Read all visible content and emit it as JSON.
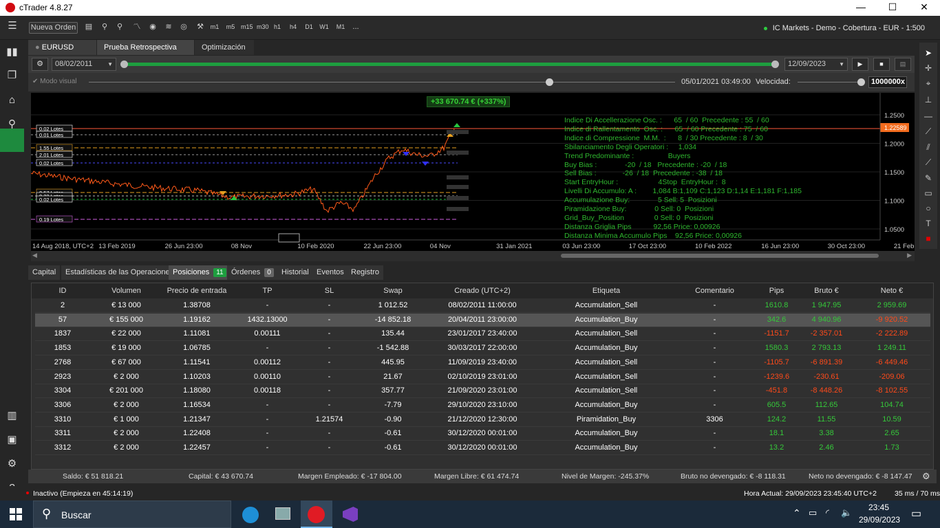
{
  "window": {
    "title": "cTrader 4.8.27"
  },
  "toolbar": {
    "new_order": "Nueva Orden",
    "timeframes": [
      "m1",
      "m5",
      "m15",
      "m30",
      "h1",
      "h4",
      "D1",
      "W1",
      "M1"
    ],
    "more": "...",
    "account": "IC Markets - Demo - Cobertura - EUR - 1:500"
  },
  "tabs": {
    "symbol": "EURUSD",
    "timeframe": "D1",
    "backtest": "Prueba Retrospectiva",
    "optimization": "Optimización"
  },
  "backtest": {
    "start_date": "08/02/2011",
    "end_date": "12/09/2023",
    "visual_mode": "Modo visual",
    "current_time": "05/01/2021 03:49:00",
    "speed_label": "Velocidad:",
    "speed_value": "1000000x"
  },
  "chart": {
    "profit_label": "+33 670.74 € (+337%)",
    "price_label": "1.22589",
    "y_ticks": [
      "1.2500",
      "1.2000",
      "1.1500",
      "1.1000",
      "1.0500"
    ],
    "y_tick_values": [
      1.25,
      1.2,
      1.15,
      1.1,
      1.05
    ],
    "x_ticks": [
      "14 Aug 2018, UTC+2",
      "13 Feb 2019",
      "26 Jun 23:00",
      "08 Nov",
      "10 Feb 2020",
      "22 Jun 23:00",
      "04 Nov",
      "31 Jan 2021",
      "03 Jun 23:00",
      "17 Oct 23:00",
      "10 Feb 2022",
      "16 Jun 23:00",
      "30 Oct 23:00",
      "21 Feb 2023"
    ],
    "lot_labels": [
      "0.02 Lotes",
      "0.01 Lotes",
      "1.55 Lotes",
      "2.01 Lotes",
      "0.02 Lotes",
      "0.57 Lotes",
      "0.22 Lotes",
      "0.02 Lotes",
      "0.19 Lotes"
    ],
    "info_lines": [
      "Indice Di Accellerazione Osc. :      65  / 60  Precedente : 55  / 60",
      "Indice di Rallentamento  Osc. :      65  / 60 Precedente : 75  / 60",
      "Indice di Compressione  M.M.  :      8  / 30 Precedente : 8  / 30",
      "Sbilanciamento Degli Operatori :     1,034",
      "Trend Predominante :                 Buyers",
      "Buy Bias :              -20  / 18   Precedente : -20  / 18",
      "Sell Bias :             -26  / 18  Precedente : -38  / 18",
      "Start EntryHour :                    4Stop  EntryHour :  8",
      "Livelli Di Accumulo: A :        1,084 B:1,109 C:1,123 D:1,14 E:1,181 F:1,185",
      "Accumulazione Buy:              5 Sell: 5  Posizioni",
      "Piramidazione Buy:              0 Sell: 0  Posizioni",
      "Grid_Buy_Position               0 Sell: 0  Posizioni",
      "Distanza Griglia Pips           92,56 Price: 0,00926",
      "Distanza Minima Accumulo Pips    92,56 Price: 0,00926"
    ]
  },
  "bottom_tabs": {
    "capital": "Capital",
    "stats": "Estadísticas de las Operaciones",
    "positions": "Posiciones",
    "positions_count": "11",
    "orders": "Órdenes",
    "orders_count": "0",
    "history": "Historial",
    "events": "Eventos",
    "log": "Registro"
  },
  "table": {
    "headers": [
      "ID",
      "Volumen",
      "Precio de entrada",
      "TP",
      "SL",
      "Swap",
      "Creado (UTC+2)",
      "Etiqueta",
      "Comentario",
      "Pips",
      "Bruto €",
      "Neto €"
    ],
    "rows": [
      [
        "2",
        "€ 13 000",
        "1.38708",
        "-",
        "-",
        "1 012.52",
        "08/02/2011 11:00:00",
        "Accumulation_Sell",
        "-",
        "1610.8",
        "1 947.95",
        "2 959.69"
      ],
      [
        "57",
        "€ 155 000",
        "1.19162",
        "1432.13000",
        "-",
        "-14 852.18",
        "20/04/2011 23:00:00",
        "Accumulation_Buy",
        "-",
        "342.6",
        "4 940.96",
        "-9 920.52"
      ],
      [
        "1837",
        "€ 22 000",
        "1.11081",
        "0.00111",
        "-",
        "135.44",
        "23/01/2017 23:40:00",
        "Accumulation_Sell",
        "-",
        "-1151.7",
        "-2 357.01",
        "-2 222.89"
      ],
      [
        "1853",
        "€ 19 000",
        "1.06785",
        "-",
        "-",
        "-1 542.88",
        "30/03/2017 22:00:00",
        "Accumulation_Buy",
        "-",
        "1580.3",
        "2 793.13",
        "1 249.11"
      ],
      [
        "2768",
        "€ 67 000",
        "1.11541",
        "0.00112",
        "-",
        "445.95",
        "11/09/2019 23:40:00",
        "Accumulation_Sell",
        "-",
        "-1105.7",
        "-6 891.39",
        "-6 449.46"
      ],
      [
        "2923",
        "€ 2 000",
        "1.10203",
        "0.00110",
        "-",
        "21.67",
        "02/10/2019 23:01:00",
        "Accumulation_Sell",
        "-",
        "-1239.6",
        "-230.61",
        "-209.06"
      ],
      [
        "3304",
        "€ 201 000",
        "1.18080",
        "0.00118",
        "-",
        "357.77",
        "21/09/2020 23:01:00",
        "Accumulation_Sell",
        "-",
        "-451.8",
        "-8 448.26",
        "-8 102.55"
      ],
      [
        "3306",
        "€ 2 000",
        "1.16534",
        "-",
        "-",
        "-7.79",
        "29/10/2020 23:10:00",
        "Accumulation_Buy",
        "-",
        "605.5",
        "112.65",
        "104.74"
      ],
      [
        "3310",
        "€ 1 000",
        "1.21347",
        "-",
        "1.21574",
        "-0.90",
        "21/12/2020 12:30:00",
        "Piramidation_Buy",
        "3306",
        "124.2",
        "11.55",
        "10.59"
      ],
      [
        "3311",
        "€ 2 000",
        "1.22408",
        "-",
        "-",
        "-0.61",
        "30/12/2020 00:01:00",
        "Accumulation_Buy",
        "-",
        "18.1",
        "3.38",
        "2.65"
      ],
      [
        "3312",
        "€ 2 000",
        "1.22457",
        "-",
        "-",
        "-0.61",
        "30/12/2020 00:01:00",
        "Accumulation_Buy",
        "-",
        "13.2",
        "2.46",
        "1.73"
      ]
    ]
  },
  "status": {
    "saldo": "Saldo: € 51 818.21",
    "capital": "Capital: € 43 670.74",
    "margen_emp": "Margen Empleado: € -17 804.00",
    "margen_libre": "Margen Libre: € 61 474.74",
    "nivel": "Nivel de Margen: -245.37%",
    "bruto": "Bruto no devengado: € -8 118.31",
    "neto": "Neto no devengado: € -8 147.47"
  },
  "footer": {
    "inactive": "Inactivo (Empieza en 45:14:19)",
    "server_time": "Hora Actual:  29/09/2023 23:45:40   UTC+2",
    "latency": "35 ms / 70 ms"
  },
  "taskbar": {
    "search": "Buscar",
    "time": "23:45",
    "date": "29/09/2023"
  },
  "colors": {
    "accent": "#1e9e3f",
    "positive": "#35c93a",
    "negative": "#ff4a1a",
    "price_label": "#f26b1d"
  }
}
